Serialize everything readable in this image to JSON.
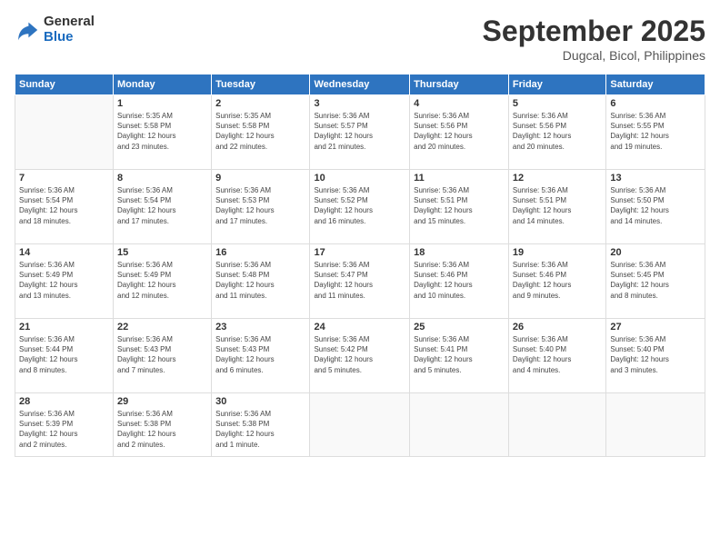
{
  "logo": {
    "general": "General",
    "blue": "Blue"
  },
  "title": "September 2025",
  "location": "Dugcal, Bicol, Philippines",
  "weekdays": [
    "Sunday",
    "Monday",
    "Tuesday",
    "Wednesday",
    "Thursday",
    "Friday",
    "Saturday"
  ],
  "weeks": [
    [
      {
        "day": "",
        "info": ""
      },
      {
        "day": "1",
        "info": "Sunrise: 5:35 AM\nSunset: 5:58 PM\nDaylight: 12 hours\nand 23 minutes."
      },
      {
        "day": "2",
        "info": "Sunrise: 5:35 AM\nSunset: 5:58 PM\nDaylight: 12 hours\nand 22 minutes."
      },
      {
        "day": "3",
        "info": "Sunrise: 5:36 AM\nSunset: 5:57 PM\nDaylight: 12 hours\nand 21 minutes."
      },
      {
        "day": "4",
        "info": "Sunrise: 5:36 AM\nSunset: 5:56 PM\nDaylight: 12 hours\nand 20 minutes."
      },
      {
        "day": "5",
        "info": "Sunrise: 5:36 AM\nSunset: 5:56 PM\nDaylight: 12 hours\nand 20 minutes."
      },
      {
        "day": "6",
        "info": "Sunrise: 5:36 AM\nSunset: 5:55 PM\nDaylight: 12 hours\nand 19 minutes."
      }
    ],
    [
      {
        "day": "7",
        "info": "Sunrise: 5:36 AM\nSunset: 5:54 PM\nDaylight: 12 hours\nand 18 minutes."
      },
      {
        "day": "8",
        "info": "Sunrise: 5:36 AM\nSunset: 5:54 PM\nDaylight: 12 hours\nand 17 minutes."
      },
      {
        "day": "9",
        "info": "Sunrise: 5:36 AM\nSunset: 5:53 PM\nDaylight: 12 hours\nand 17 minutes."
      },
      {
        "day": "10",
        "info": "Sunrise: 5:36 AM\nSunset: 5:52 PM\nDaylight: 12 hours\nand 16 minutes."
      },
      {
        "day": "11",
        "info": "Sunrise: 5:36 AM\nSunset: 5:51 PM\nDaylight: 12 hours\nand 15 minutes."
      },
      {
        "day": "12",
        "info": "Sunrise: 5:36 AM\nSunset: 5:51 PM\nDaylight: 12 hours\nand 14 minutes."
      },
      {
        "day": "13",
        "info": "Sunrise: 5:36 AM\nSunset: 5:50 PM\nDaylight: 12 hours\nand 14 minutes."
      }
    ],
    [
      {
        "day": "14",
        "info": "Sunrise: 5:36 AM\nSunset: 5:49 PM\nDaylight: 12 hours\nand 13 minutes."
      },
      {
        "day": "15",
        "info": "Sunrise: 5:36 AM\nSunset: 5:49 PM\nDaylight: 12 hours\nand 12 minutes."
      },
      {
        "day": "16",
        "info": "Sunrise: 5:36 AM\nSunset: 5:48 PM\nDaylight: 12 hours\nand 11 minutes."
      },
      {
        "day": "17",
        "info": "Sunrise: 5:36 AM\nSunset: 5:47 PM\nDaylight: 12 hours\nand 11 minutes."
      },
      {
        "day": "18",
        "info": "Sunrise: 5:36 AM\nSunset: 5:46 PM\nDaylight: 12 hours\nand 10 minutes."
      },
      {
        "day": "19",
        "info": "Sunrise: 5:36 AM\nSunset: 5:46 PM\nDaylight: 12 hours\nand 9 minutes."
      },
      {
        "day": "20",
        "info": "Sunrise: 5:36 AM\nSunset: 5:45 PM\nDaylight: 12 hours\nand 8 minutes."
      }
    ],
    [
      {
        "day": "21",
        "info": "Sunrise: 5:36 AM\nSunset: 5:44 PM\nDaylight: 12 hours\nand 8 minutes."
      },
      {
        "day": "22",
        "info": "Sunrise: 5:36 AM\nSunset: 5:43 PM\nDaylight: 12 hours\nand 7 minutes."
      },
      {
        "day": "23",
        "info": "Sunrise: 5:36 AM\nSunset: 5:43 PM\nDaylight: 12 hours\nand 6 minutes."
      },
      {
        "day": "24",
        "info": "Sunrise: 5:36 AM\nSunset: 5:42 PM\nDaylight: 12 hours\nand 5 minutes."
      },
      {
        "day": "25",
        "info": "Sunrise: 5:36 AM\nSunset: 5:41 PM\nDaylight: 12 hours\nand 5 minutes."
      },
      {
        "day": "26",
        "info": "Sunrise: 5:36 AM\nSunset: 5:40 PM\nDaylight: 12 hours\nand 4 minutes."
      },
      {
        "day": "27",
        "info": "Sunrise: 5:36 AM\nSunset: 5:40 PM\nDaylight: 12 hours\nand 3 minutes."
      }
    ],
    [
      {
        "day": "28",
        "info": "Sunrise: 5:36 AM\nSunset: 5:39 PM\nDaylight: 12 hours\nand 2 minutes."
      },
      {
        "day": "29",
        "info": "Sunrise: 5:36 AM\nSunset: 5:38 PM\nDaylight: 12 hours\nand 2 minutes."
      },
      {
        "day": "30",
        "info": "Sunrise: 5:36 AM\nSunset: 5:38 PM\nDaylight: 12 hours\nand 1 minute."
      },
      {
        "day": "",
        "info": ""
      },
      {
        "day": "",
        "info": ""
      },
      {
        "day": "",
        "info": ""
      },
      {
        "day": "",
        "info": ""
      }
    ]
  ]
}
